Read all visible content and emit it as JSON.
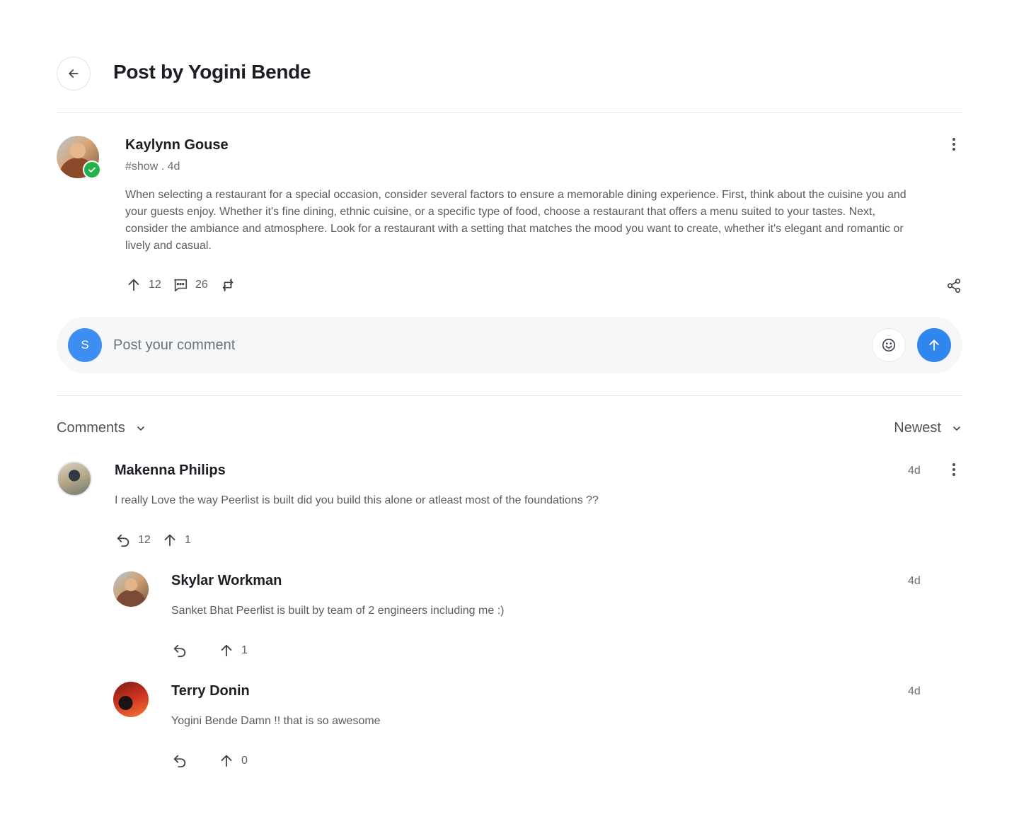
{
  "header": {
    "title": "Post by Yogini Bende"
  },
  "post": {
    "author": "Kaylynn Gouse",
    "meta": "#show . 4d",
    "body": "When selecting a restaurant for a special occasion, consider several factors to ensure a memorable dining experience. First, think about the cuisine you and your guests enjoy. Whether it's fine dining, ethnic cuisine, or a specific type of food, choose a restaurant that offers a menu suited to your tastes. Next, consider the ambiance and atmosphere. Look for a restaurant with a setting that matches the mood you want to create, whether it's elegant and romantic or lively and casual.",
    "upvotes": "12",
    "comments": "26"
  },
  "composer": {
    "avatar_initial": "S",
    "placeholder": "Post your comment"
  },
  "comments_section": {
    "label": "Comments",
    "sort": "Newest"
  },
  "comments": [
    {
      "name": "Makenna Philips",
      "time": "4d",
      "text": "I really Love the way Peerlist is built did you build this alone or atleast most of the foundations ??",
      "replies": "12",
      "upvotes": "1"
    },
    {
      "name": "Skylar Workman",
      "time": "4d",
      "text": "Sanket Bhat Peerlist is built by team of 2 engineers including me :)",
      "upvotes": "1"
    },
    {
      "name": "Terry Donin",
      "time": "4d",
      "text": "Yogini Bende Damn !! that is so awesome",
      "upvotes": "0"
    }
  ],
  "colors": {
    "accent": "#2f86ee",
    "verified": "#22b24c",
    "composer_bg": "#f6f7f8"
  }
}
